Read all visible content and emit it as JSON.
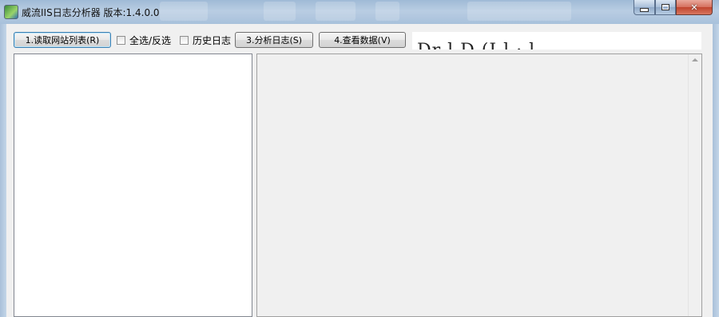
{
  "window": {
    "title": "威流IIS日志分析器 版本:1.4.0.0",
    "controls": {
      "minimize": "minimize",
      "maximize": "maximize",
      "close": "✕"
    }
  },
  "toolbar": {
    "load_sites_label": "1.读取网站列表(R)",
    "select_all_label": "全选/反选",
    "history_log_label": "历史日志",
    "analyze_label": "3.分析日志(S)",
    "view_data_label": "4.查看数据(V)"
  },
  "ad_banner": {
    "text": "Dr l  D             (I     l · l"
  },
  "colors": {
    "titlebar": "#a8c1db",
    "client": "#f0f0f0",
    "close_button": "#c0442e"
  }
}
